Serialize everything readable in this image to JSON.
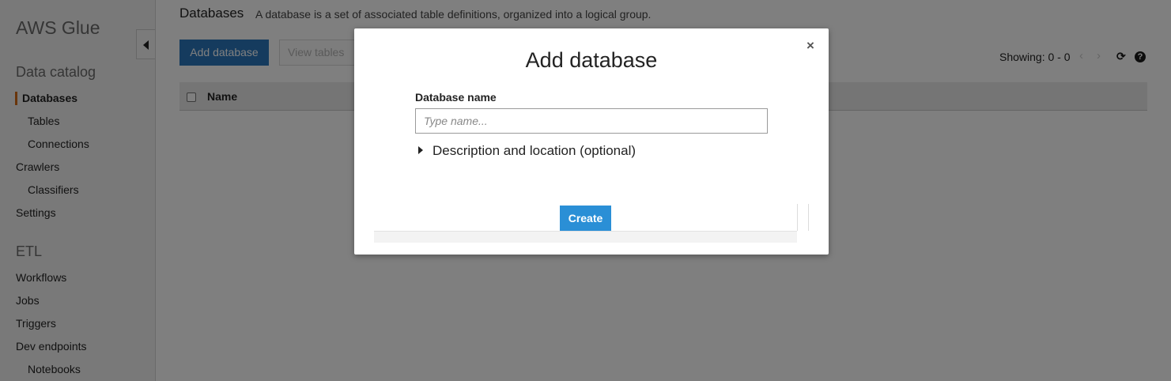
{
  "sidebar": {
    "brand": "AWS Glue",
    "sections": [
      {
        "heading": "Data catalog"
      },
      {
        "heading": "ETL"
      }
    ],
    "items": {
      "databases": "Databases",
      "tables": "Tables",
      "connections": "Connections",
      "crawlers": "Crawlers",
      "classifiers": "Classifiers",
      "settings": "Settings",
      "workflows": "Workflows",
      "jobs": "Jobs",
      "triggers": "Triggers",
      "dev_endpoints": "Dev endpoints",
      "notebooks": "Notebooks"
    },
    "active_item": "Databases",
    "accent_color": "#d36b16"
  },
  "main": {
    "title": "Databases",
    "description": "A database is a set of associated table definitions, organized into a logical group.",
    "toolbar": {
      "add_label": "Add database",
      "view_tables_label": "View tables"
    },
    "showing": "Showing: 0 - 0",
    "table": {
      "columns": [
        "Name"
      ]
    }
  },
  "modal": {
    "title": "Add database",
    "field_label": "Database name",
    "field_value": "",
    "field_placeholder": "Type name...",
    "expander_label": "Description and location (optional)",
    "create_label": "Create",
    "close_glyph": "×"
  },
  "icons": {
    "prev": "‹",
    "next": "›",
    "refresh": "⟳",
    "help": "?"
  },
  "colors": {
    "primary": "#2a77bd",
    "create": "#2a8fd6"
  }
}
